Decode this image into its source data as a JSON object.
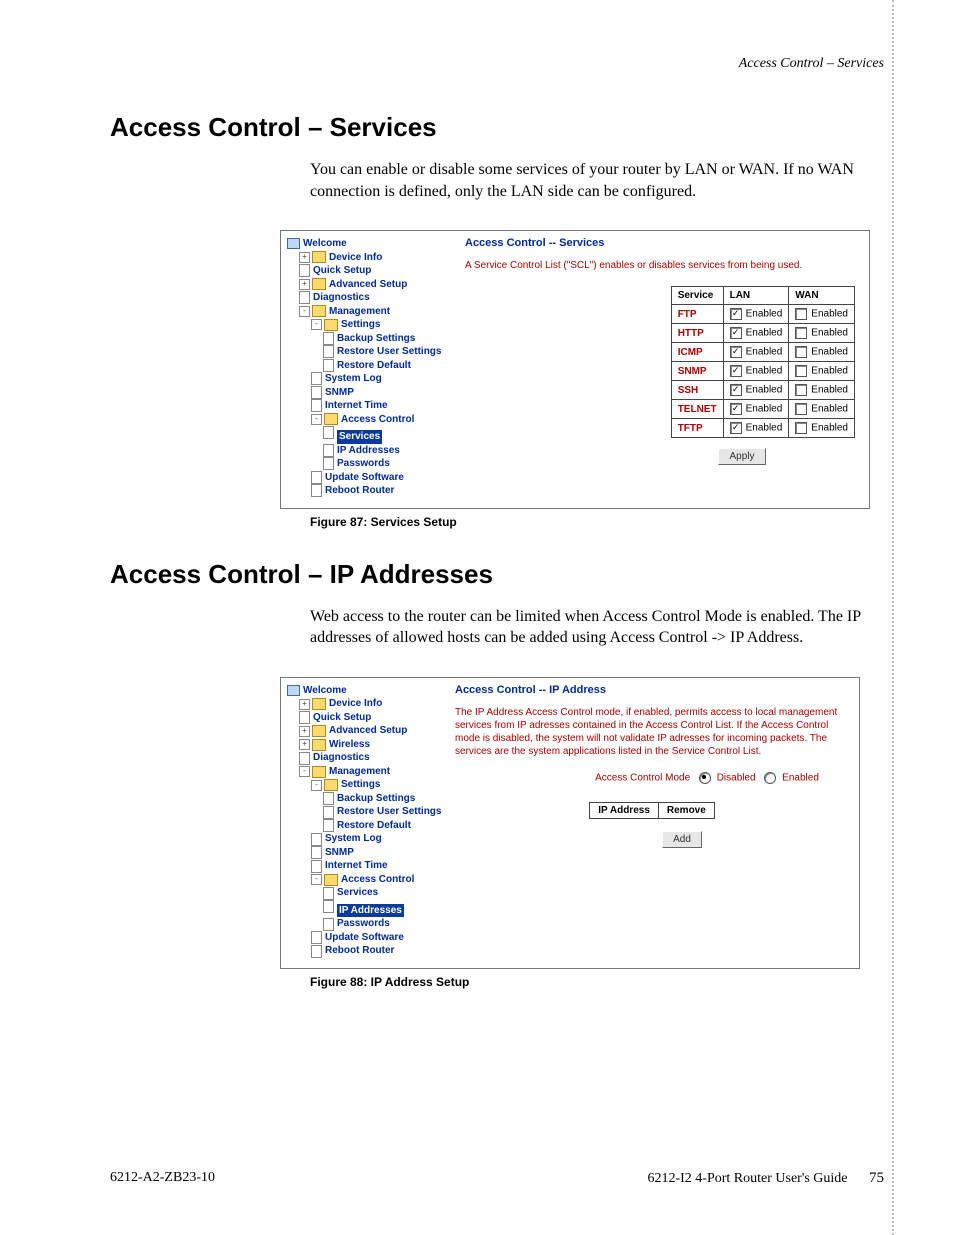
{
  "header_breadcrumb": "Access Control – Services",
  "section1": {
    "heading": "Access Control – Services",
    "para": "You can enable or disable some services of your router by LAN or WAN. If no WAN connection is defined, only the LAN side can be configured.",
    "fig_caption": "Figure 87: Services Setup",
    "panel_heading": "Access Control -- Services",
    "panel_desc": "A Service Control List (\"SCL\") enables or disables services from being used.",
    "table": {
      "cols": [
        "Service",
        "LAN",
        "WAN"
      ],
      "label_enabled": "Enabled",
      "rows": [
        {
          "name": "FTP",
          "lan": true,
          "wan": false
        },
        {
          "name": "HTTP",
          "lan": true,
          "wan": false
        },
        {
          "name": "ICMP",
          "lan": true,
          "wan": false
        },
        {
          "name": "SNMP",
          "lan": true,
          "wan": false
        },
        {
          "name": "SSH",
          "lan": true,
          "wan": false
        },
        {
          "name": "TELNET",
          "lan": true,
          "wan": false
        },
        {
          "name": "TFTP",
          "lan": true,
          "wan": false
        }
      ]
    },
    "apply_label": "Apply"
  },
  "section2": {
    "heading": "Access Control – IP Addresses",
    "para": "Web access to the router can be limited when Access Control Mode is enabled. The IP addresses of allowed hosts can be added using Access Control -> IP Address.",
    "fig_caption": "Figure 88: IP Address Setup",
    "panel_heading": "Access Control -- IP Address",
    "panel_desc": "The IP Address Access Control mode, if enabled, permits access to local management services from IP adresses contained in the Access Control List. If the Access Control mode is disabled, the system will not validate IP adresses for incoming packets. The services are the system applications listed in the Service Control List.",
    "mode_label": "Access Control Mode",
    "mode_disabled": "Disabled",
    "mode_enabled": "Enabled",
    "mode_value": "Disabled",
    "ip_table_cols": [
      "IP Address",
      "Remove"
    ],
    "add_label": "Add"
  },
  "tree1": {
    "items": [
      {
        "t": "pc",
        "l": "Welcome",
        "i": 0
      },
      {
        "t": "fld",
        "exp": "+",
        "l": "Device Info",
        "i": 1
      },
      {
        "t": "doc",
        "l": "Quick Setup",
        "i": 1
      },
      {
        "t": "fld",
        "exp": "+",
        "l": "Advanced Setup",
        "i": 1
      },
      {
        "t": "doc",
        "l": "Diagnostics",
        "i": 1
      },
      {
        "t": "fld",
        "exp": "-",
        "l": "Management",
        "i": 1
      },
      {
        "t": "fld",
        "exp": "-",
        "l": "Settings",
        "i": 2
      },
      {
        "t": "doc",
        "l": "Backup Settings",
        "i": 3
      },
      {
        "t": "doc",
        "l": "Restore User Settings",
        "i": 3
      },
      {
        "t": "doc",
        "l": "Restore Default",
        "i": 3
      },
      {
        "t": "doc",
        "l": "System Log",
        "i": 2
      },
      {
        "t": "doc",
        "l": "SNMP",
        "i": 2
      },
      {
        "t": "doc",
        "l": "Internet Time",
        "i": 2
      },
      {
        "t": "fld",
        "exp": "-",
        "l": "Access Control",
        "i": 2
      },
      {
        "t": "doc",
        "l": "Services",
        "i": 3,
        "sel": true
      },
      {
        "t": "doc",
        "l": "IP Addresses",
        "i": 3
      },
      {
        "t": "doc",
        "l": "Passwords",
        "i": 3
      },
      {
        "t": "doc",
        "l": "Update Software",
        "i": 2
      },
      {
        "t": "doc",
        "l": "Reboot Router",
        "i": 2
      }
    ]
  },
  "tree2": {
    "items": [
      {
        "t": "pc",
        "l": "Welcome",
        "i": 0
      },
      {
        "t": "fld",
        "exp": "+",
        "l": "Device Info",
        "i": 1
      },
      {
        "t": "doc",
        "l": "Quick Setup",
        "i": 1
      },
      {
        "t": "fld",
        "exp": "+",
        "l": "Advanced Setup",
        "i": 1
      },
      {
        "t": "fld",
        "exp": "+",
        "l": "Wireless",
        "i": 1
      },
      {
        "t": "doc",
        "l": "Diagnostics",
        "i": 1
      },
      {
        "t": "fld",
        "exp": "-",
        "l": "Management",
        "i": 1
      },
      {
        "t": "fld",
        "exp": "-",
        "l": "Settings",
        "i": 2
      },
      {
        "t": "doc",
        "l": "Backup Settings",
        "i": 3
      },
      {
        "t": "doc",
        "l": "Restore User Settings",
        "i": 3
      },
      {
        "t": "doc",
        "l": "Restore Default",
        "i": 3
      },
      {
        "t": "doc",
        "l": "System Log",
        "i": 2
      },
      {
        "t": "doc",
        "l": "SNMP",
        "i": 2
      },
      {
        "t": "doc",
        "l": "Internet Time",
        "i": 2
      },
      {
        "t": "fld",
        "exp": "-",
        "l": "Access Control",
        "i": 2
      },
      {
        "t": "doc",
        "l": "Services",
        "i": 3
      },
      {
        "t": "doc",
        "l": "IP Addresses",
        "i": 3,
        "sel": true
      },
      {
        "t": "doc",
        "l": "Passwords",
        "i": 3
      },
      {
        "t": "doc",
        "l": "Update Software",
        "i": 2
      },
      {
        "t": "doc",
        "l": "Reboot Router",
        "i": 2
      }
    ]
  },
  "footer": {
    "left": "6212-A2-ZB23-10",
    "right": "6212-I2 4-Port Router User's Guide",
    "page": "75"
  }
}
